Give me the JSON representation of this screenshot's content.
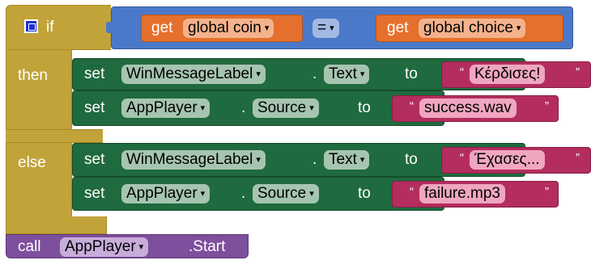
{
  "if_block": {
    "keyword_if": "if",
    "keyword_then": "then",
    "keyword_else": "else",
    "mutator_icon": "gear-icon"
  },
  "condition": {
    "left_get": "get",
    "left_var": "global coin",
    "operator": "=",
    "right_get": "get",
    "right_var": "global choice"
  },
  "then_branch": [
    {
      "set": "set",
      "component": "WinMessageLabel",
      "dot": ".",
      "property": "Text",
      "to": "to",
      "value": "Κέρδισες!"
    },
    {
      "set": "set",
      "component": "AppPlayer",
      "dot": ".",
      "property": "Source",
      "to": "to",
      "value": "success.wav"
    }
  ],
  "else_branch": [
    {
      "set": "set",
      "component": "WinMessageLabel",
      "dot": ".",
      "property": "Text",
      "to": "to",
      "value": "Έχασες..."
    },
    {
      "set": "set",
      "component": "AppPlayer",
      "dot": ".",
      "property": "Source",
      "to": "to",
      "value": "failure.mp3"
    }
  ],
  "call_block": {
    "call": "call",
    "component": "AppPlayer",
    "method": ".Start"
  },
  "quote_open": "“",
  "quote_close": "”",
  "dropdown_glyph": "▾",
  "colors": {
    "control": "#c1a33a",
    "logic": "#4a79c9",
    "variable": "#e5702d",
    "component": "#1f6a3e",
    "text": "#b32d5e",
    "call": "#7d4f9c"
  }
}
